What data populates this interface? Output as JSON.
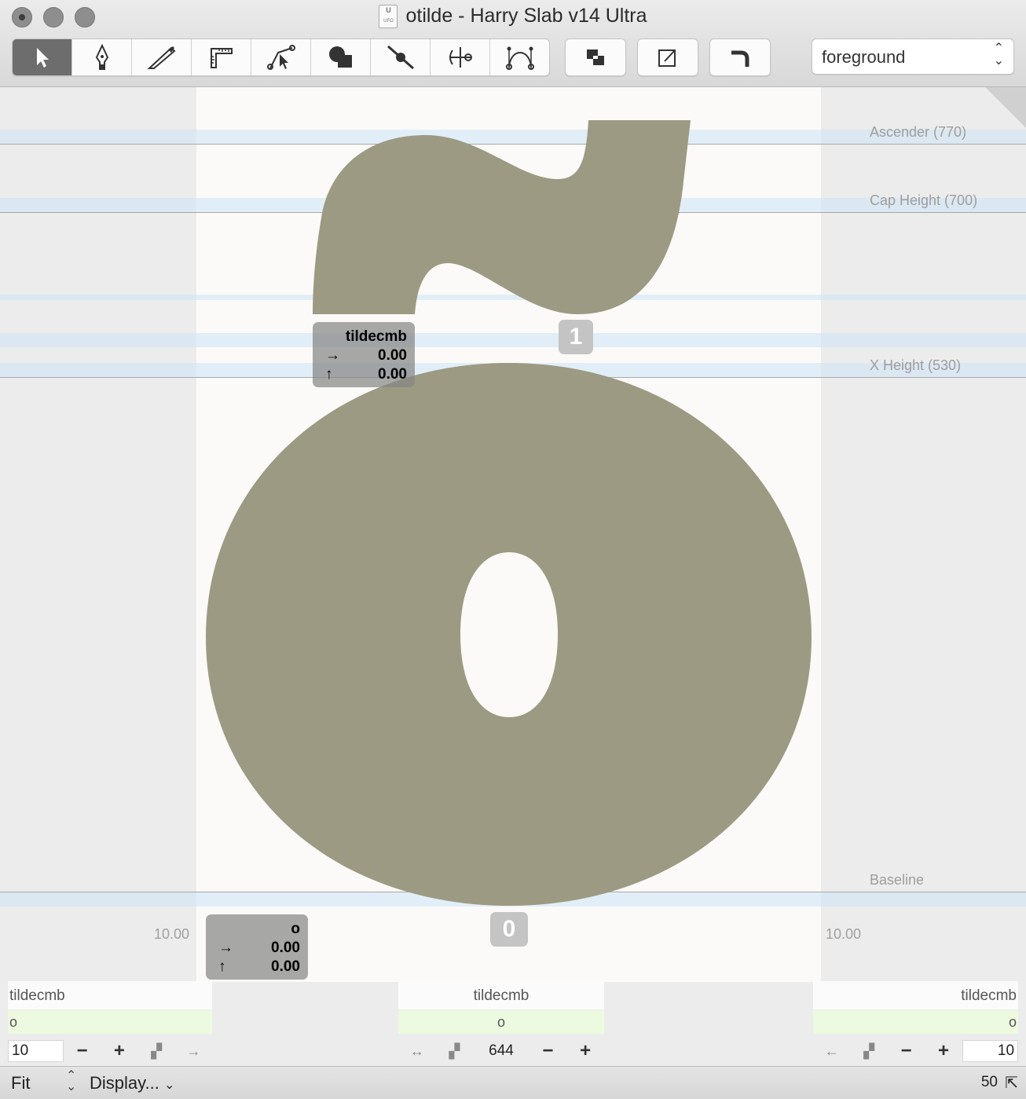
{
  "window": {
    "title": "otilde - Harry Slab v14 Ultra",
    "doc_icon": {
      "top": "U",
      "bottom": "UFO"
    }
  },
  "toolbar": {
    "tools": [
      "select-tool",
      "pen-tool",
      "knife-tool",
      "measure-tool",
      "edit-points-tool",
      "shape-tool",
      "slice-tool",
      "transform-tool",
      "bezier-tool"
    ],
    "actions": [
      "flip-layers",
      "transform-box",
      "corner"
    ],
    "layer_select": "foreground"
  },
  "metrics": {
    "ascender": "Ascender (770)",
    "cap_height": "Cap Height (700)",
    "x_height": "X Height (530)",
    "baseline": "Baseline"
  },
  "components": {
    "tilde": {
      "name": "tildecmb",
      "x": "0.00",
      "y": "0.00",
      "index": "1"
    },
    "base": {
      "name": "o",
      "x": "0.00",
      "y": "0.00",
      "index": "0"
    }
  },
  "sidebearings": {
    "left": "10.00",
    "right": "10.00"
  },
  "bottom": {
    "left": {
      "glyph_above": "tildecmb",
      "glyph": "o",
      "value": "10"
    },
    "center": {
      "glyph_above": "tildecmb",
      "glyph": "o",
      "width": "644"
    },
    "right": {
      "glyph_above": "tildecmb",
      "glyph": "o",
      "value": "10"
    }
  },
  "status": {
    "zoom_mode": "Fit",
    "display_menu": "Display...",
    "zoom_value": "50"
  },
  "colors": {
    "glyph_fill": "#9c9a82",
    "guide_band": "#cde4f5",
    "kern_green": "#ecfae0"
  }
}
